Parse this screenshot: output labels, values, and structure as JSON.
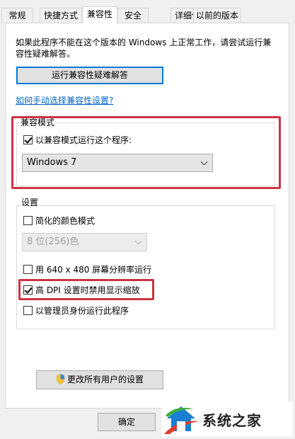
{
  "tabs": [
    {
      "label": "常规"
    },
    {
      "label": "快捷方式"
    },
    {
      "label": "兼容性",
      "active": true
    },
    {
      "label": "安全"
    },
    {
      "label": "详细信息"
    },
    {
      "label": "以前的版本"
    }
  ],
  "description": "如果此程序不能在这个版本的 Windows 上正常工作，请尝试运行兼容性疑难解答。",
  "troubleshoot_button": "运行兼容性疑难解答",
  "manual_link": "如何手动选择兼容性设置?",
  "compat_mode": {
    "legend": "兼容模式",
    "checkbox_label": "以兼容模式运行这个程序:",
    "checked": true,
    "os_select_value": "Windows 7"
  },
  "settings": {
    "legend": "设置",
    "reduced_color": {
      "label": "简化的颜色模式",
      "checked": false
    },
    "color_select_value": "8 位(256)色",
    "low_res": {
      "label": "用 640 x 480 屏幕分辨率运行",
      "checked": false
    },
    "high_dpi": {
      "label": "高 DPI 设置时禁用显示缩放",
      "checked": true
    },
    "run_admin": {
      "label": "以管理员身份运行此程序",
      "checked": false
    }
  },
  "all_users_button": "更改所有用户的设置",
  "ok_button": "确定",
  "watermark": {
    "text": "系统之家"
  },
  "colors": {
    "highlight": "#cc3344",
    "link": "#0066cc",
    "focus": "#0078d7"
  },
  "icons": {
    "shield": "uac-shield-icon",
    "watermark_logo": "house-logo-icon"
  }
}
